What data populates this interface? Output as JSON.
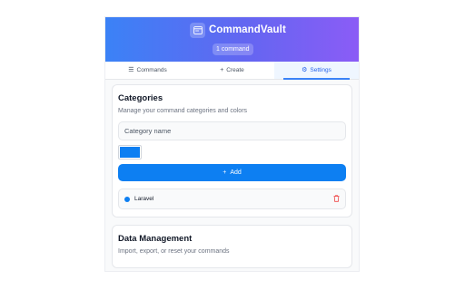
{
  "app": {
    "title": "CommandVault",
    "command_count": "1 command",
    "brand_gradient": [
      "#3b82f6",
      "#6366f1",
      "#8b5cf6"
    ]
  },
  "tabs": [
    {
      "label": "Commands",
      "icon": "list-icon",
      "active": false
    },
    {
      "label": "Create",
      "icon": "plus-icon",
      "active": false
    },
    {
      "label": "Settings",
      "icon": "gear-icon",
      "active": true
    }
  ],
  "categories": {
    "title": "Categories",
    "subtitle": "Manage your command categories and colors",
    "name_placeholder": "Category name",
    "selected_color": "#0d7ff2",
    "add_label": "Add",
    "items": [
      {
        "name": "Laravel",
        "color": "#0d7ff2"
      }
    ]
  },
  "data_management": {
    "title": "Data Management",
    "subtitle": "Import, export, or reset your commands"
  }
}
